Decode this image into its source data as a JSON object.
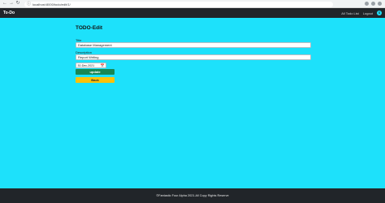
{
  "browser": {
    "back_glyph": "←",
    "forward_glyph": "→",
    "reload_glyph": "↻",
    "lock_glyph": "ⓘ",
    "url": "localhost:8000/todo/edit/1/"
  },
  "navbar": {
    "brand": "To-Do",
    "links": [
      "All Todo List",
      "Logout"
    ],
    "avatar_initial": "S"
  },
  "form": {
    "title": "TODO-Edit",
    "title_field": {
      "label": "Title",
      "value": "Database Management"
    },
    "description_field": {
      "label": "Description",
      "value": "Report Writing"
    },
    "date_field": {
      "value": "30-Dec-2021",
      "icon": "calendar-icon"
    },
    "update_button": "update",
    "back_button": "Back"
  },
  "footer": {
    "text": "©Fantastic Four Alpha 2021.All Copy Rights Reserve"
  },
  "colors": {
    "page_background": "#1de1fb",
    "navbar": "#212529",
    "update_button": "#198754",
    "back_button": "#ffc107"
  }
}
